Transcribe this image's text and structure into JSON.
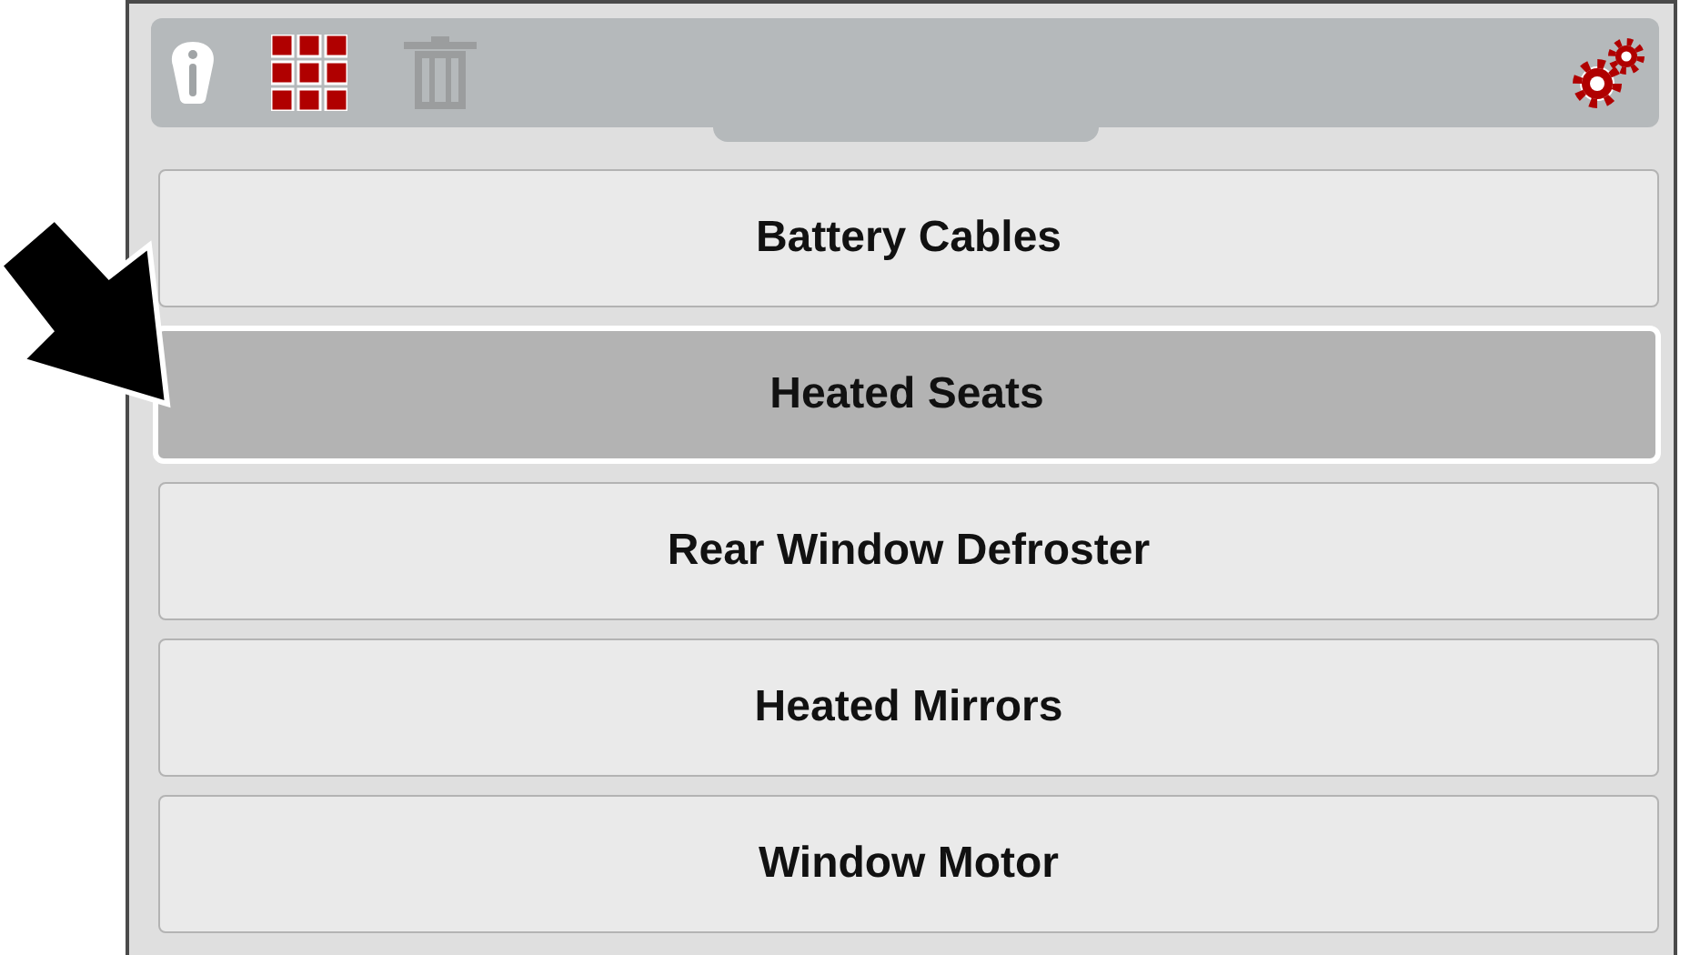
{
  "toolbar": {
    "tools": [
      {
        "kind": "info",
        "disabled": false
      },
      {
        "kind": "grid",
        "disabled": false
      },
      {
        "kind": "trash",
        "disabled": true
      },
      {
        "kind": "settings",
        "disabled": false
      }
    ]
  },
  "items": [
    {
      "label": "Battery Cables",
      "selected": false
    },
    {
      "label": "Heated Seats",
      "selected": true
    },
    {
      "label": "Rear Window Defroster",
      "selected": false
    },
    {
      "label": "Heated Mirrors",
      "selected": false
    },
    {
      "label": "Window Motor",
      "selected": false
    }
  ]
}
